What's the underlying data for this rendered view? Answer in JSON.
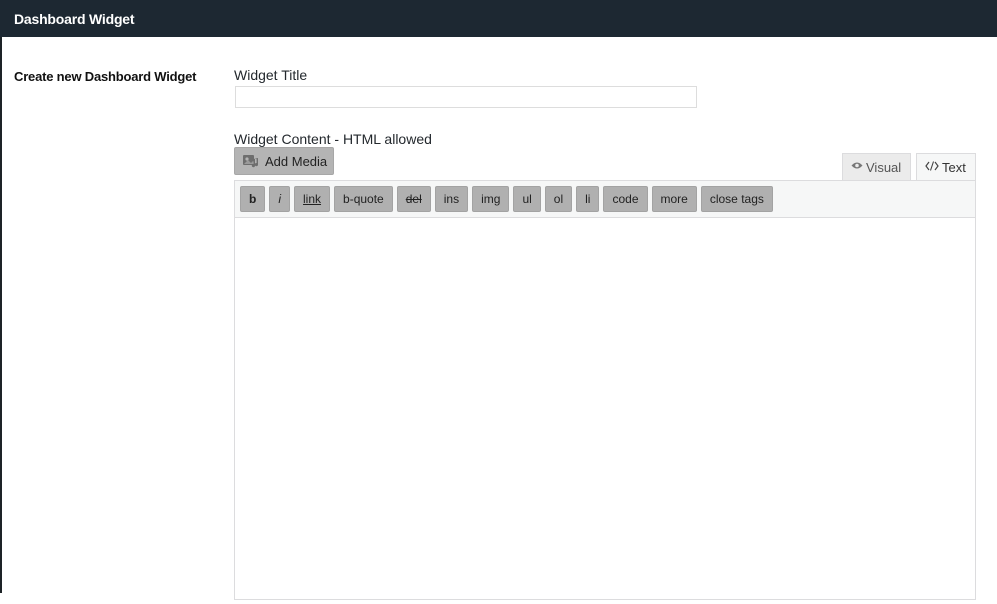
{
  "header": {
    "title": "Dashboard Widget"
  },
  "form": {
    "row_label": "Create new Dashboard Widget",
    "title_label": "Widget Title",
    "title_value": "",
    "content_label": "Widget Content - HTML allowed",
    "add_media_label": "Add Media",
    "add_media_icon": "media-icon",
    "tabs": [
      {
        "label": "Visual",
        "icon": "eye-icon",
        "active": false
      },
      {
        "label": "Text",
        "icon": "code-icon",
        "active": true
      }
    ],
    "quicktags": [
      "b",
      "i",
      "link",
      "b-quote",
      "del",
      "ins",
      "img",
      "ul",
      "ol",
      "li",
      "code",
      "more",
      "close tags"
    ],
    "content_value": ""
  },
  "colors": {
    "header_bg": "#1d2832",
    "button_bg": "#b0b0b0"
  }
}
